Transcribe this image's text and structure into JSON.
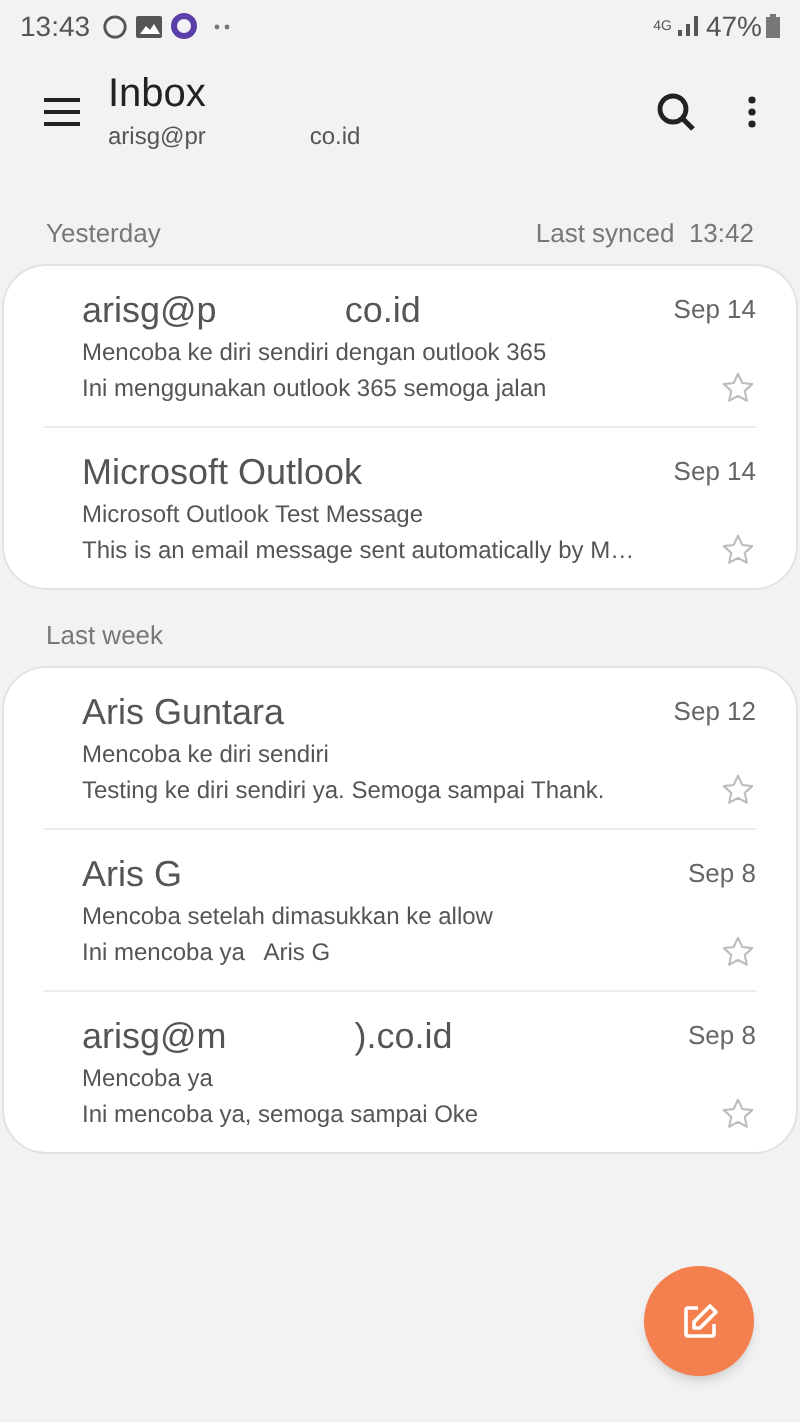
{
  "status_bar": {
    "time": "13:43",
    "network": "4G",
    "battery": "47%"
  },
  "header": {
    "title": "Inbox",
    "account_parts": [
      "arisg@pr",
      "co.id"
    ]
  },
  "sections": [
    {
      "label": "Yesterday",
      "sync_note": "Last synced  13:42",
      "messages": [
        {
          "sender_parts": [
            "arisg@p",
            "co.id"
          ],
          "date": "Sep 14",
          "subject": "Mencoba ke diri sendiri dengan outlook 365",
          "preview": "Ini menggunakan outlook 365 semoga jalan",
          "starred": false
        },
        {
          "sender_parts": [
            "Microsoft Outlook"
          ],
          "date": "Sep 14",
          "subject": "Microsoft Outlook Test Message",
          "preview": "This is an email message sent automatically by M…",
          "starred": false
        }
      ]
    },
    {
      "label": "Last week",
      "messages": [
        {
          "sender_parts": [
            "Aris Guntara"
          ],
          "date": "Sep 12",
          "subject": "Mencoba ke diri sendiri",
          "preview": "Testing ke diri sendiri ya. Semoga sampai Thank.",
          "starred": false
        },
        {
          "sender_parts": [
            "Aris G"
          ],
          "date": "Sep 8",
          "subject": "Mencoba setelah dimasukkan ke allow",
          "preview": "Ini mencoba ya   Aris G",
          "starred": false
        },
        {
          "sender_parts": [
            "arisg@m",
            ").co.id"
          ],
          "date": "Sep 8",
          "subject": "Mencoba ya",
          "preview": "Ini mencoba ya, semoga sampai Oke",
          "starred": false
        }
      ]
    }
  ]
}
